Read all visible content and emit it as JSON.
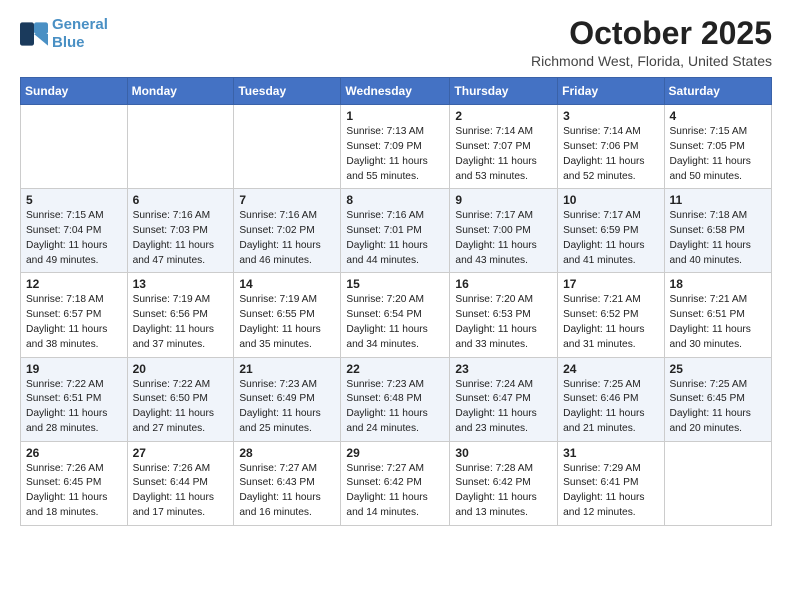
{
  "header": {
    "logo_line1": "General",
    "logo_line2": "Blue",
    "month": "October 2025",
    "location": "Richmond West, Florida, United States"
  },
  "weekdays": [
    "Sunday",
    "Monday",
    "Tuesday",
    "Wednesday",
    "Thursday",
    "Friday",
    "Saturday"
  ],
  "weeks": [
    [
      {
        "day": "",
        "text": ""
      },
      {
        "day": "",
        "text": ""
      },
      {
        "day": "",
        "text": ""
      },
      {
        "day": "1",
        "text": "Sunrise: 7:13 AM\nSunset: 7:09 PM\nDaylight: 11 hours and 55 minutes."
      },
      {
        "day": "2",
        "text": "Sunrise: 7:14 AM\nSunset: 7:07 PM\nDaylight: 11 hours and 53 minutes."
      },
      {
        "day": "3",
        "text": "Sunrise: 7:14 AM\nSunset: 7:06 PM\nDaylight: 11 hours and 52 minutes."
      },
      {
        "day": "4",
        "text": "Sunrise: 7:15 AM\nSunset: 7:05 PM\nDaylight: 11 hours and 50 minutes."
      }
    ],
    [
      {
        "day": "5",
        "text": "Sunrise: 7:15 AM\nSunset: 7:04 PM\nDaylight: 11 hours and 49 minutes."
      },
      {
        "day": "6",
        "text": "Sunrise: 7:16 AM\nSunset: 7:03 PM\nDaylight: 11 hours and 47 minutes."
      },
      {
        "day": "7",
        "text": "Sunrise: 7:16 AM\nSunset: 7:02 PM\nDaylight: 11 hours and 46 minutes."
      },
      {
        "day": "8",
        "text": "Sunrise: 7:16 AM\nSunset: 7:01 PM\nDaylight: 11 hours and 44 minutes."
      },
      {
        "day": "9",
        "text": "Sunrise: 7:17 AM\nSunset: 7:00 PM\nDaylight: 11 hours and 43 minutes."
      },
      {
        "day": "10",
        "text": "Sunrise: 7:17 AM\nSunset: 6:59 PM\nDaylight: 11 hours and 41 minutes."
      },
      {
        "day": "11",
        "text": "Sunrise: 7:18 AM\nSunset: 6:58 PM\nDaylight: 11 hours and 40 minutes."
      }
    ],
    [
      {
        "day": "12",
        "text": "Sunrise: 7:18 AM\nSunset: 6:57 PM\nDaylight: 11 hours and 38 minutes."
      },
      {
        "day": "13",
        "text": "Sunrise: 7:19 AM\nSunset: 6:56 PM\nDaylight: 11 hours and 37 minutes."
      },
      {
        "day": "14",
        "text": "Sunrise: 7:19 AM\nSunset: 6:55 PM\nDaylight: 11 hours and 35 minutes."
      },
      {
        "day": "15",
        "text": "Sunrise: 7:20 AM\nSunset: 6:54 PM\nDaylight: 11 hours and 34 minutes."
      },
      {
        "day": "16",
        "text": "Sunrise: 7:20 AM\nSunset: 6:53 PM\nDaylight: 11 hours and 33 minutes."
      },
      {
        "day": "17",
        "text": "Sunrise: 7:21 AM\nSunset: 6:52 PM\nDaylight: 11 hours and 31 minutes."
      },
      {
        "day": "18",
        "text": "Sunrise: 7:21 AM\nSunset: 6:51 PM\nDaylight: 11 hours and 30 minutes."
      }
    ],
    [
      {
        "day": "19",
        "text": "Sunrise: 7:22 AM\nSunset: 6:51 PM\nDaylight: 11 hours and 28 minutes."
      },
      {
        "day": "20",
        "text": "Sunrise: 7:22 AM\nSunset: 6:50 PM\nDaylight: 11 hours and 27 minutes."
      },
      {
        "day": "21",
        "text": "Sunrise: 7:23 AM\nSunset: 6:49 PM\nDaylight: 11 hours and 25 minutes."
      },
      {
        "day": "22",
        "text": "Sunrise: 7:23 AM\nSunset: 6:48 PM\nDaylight: 11 hours and 24 minutes."
      },
      {
        "day": "23",
        "text": "Sunrise: 7:24 AM\nSunset: 6:47 PM\nDaylight: 11 hours and 23 minutes."
      },
      {
        "day": "24",
        "text": "Sunrise: 7:25 AM\nSunset: 6:46 PM\nDaylight: 11 hours and 21 minutes."
      },
      {
        "day": "25",
        "text": "Sunrise: 7:25 AM\nSunset: 6:45 PM\nDaylight: 11 hours and 20 minutes."
      }
    ],
    [
      {
        "day": "26",
        "text": "Sunrise: 7:26 AM\nSunset: 6:45 PM\nDaylight: 11 hours and 18 minutes."
      },
      {
        "day": "27",
        "text": "Sunrise: 7:26 AM\nSunset: 6:44 PM\nDaylight: 11 hours and 17 minutes."
      },
      {
        "day": "28",
        "text": "Sunrise: 7:27 AM\nSunset: 6:43 PM\nDaylight: 11 hours and 16 minutes."
      },
      {
        "day": "29",
        "text": "Sunrise: 7:27 AM\nSunset: 6:42 PM\nDaylight: 11 hours and 14 minutes."
      },
      {
        "day": "30",
        "text": "Sunrise: 7:28 AM\nSunset: 6:42 PM\nDaylight: 11 hours and 13 minutes."
      },
      {
        "day": "31",
        "text": "Sunrise: 7:29 AM\nSunset: 6:41 PM\nDaylight: 11 hours and 12 minutes."
      },
      {
        "day": "",
        "text": ""
      }
    ]
  ]
}
